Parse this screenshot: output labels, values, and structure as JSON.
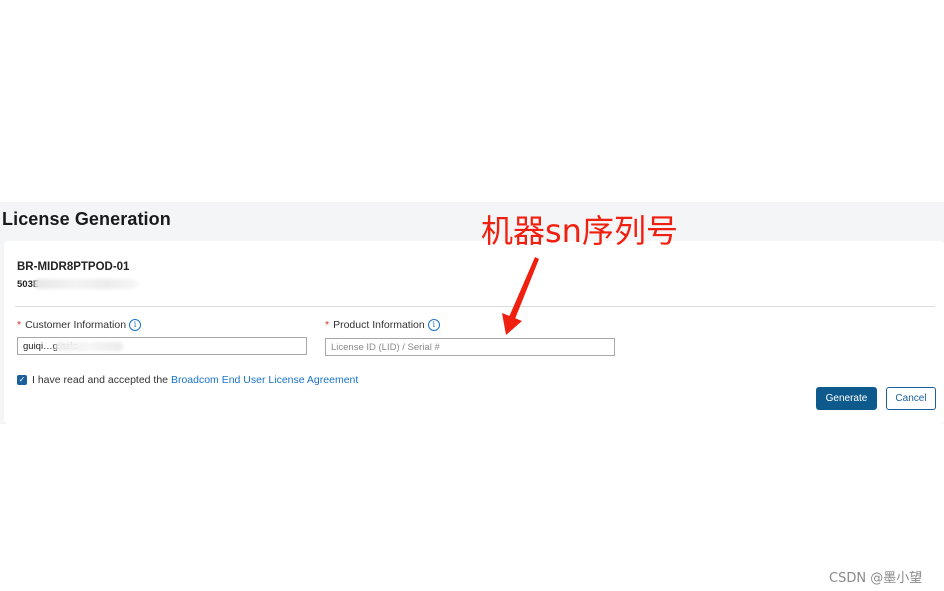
{
  "page": {
    "title": "License Generation"
  },
  "device": {
    "name": "BR-MIDR8PTPOD-01",
    "serial_visible": "503E"
  },
  "form": {
    "customer": {
      "label": "Customer Information",
      "value": "guiqi…g.asia",
      "required_mark": "*"
    },
    "product": {
      "label": "Product Information",
      "placeholder": "License ID (LID) / Serial #",
      "required_mark": "*"
    },
    "agreement": {
      "checked": true,
      "text": "I have read and accepted the ",
      "link": "Broadcom End User License Agreement"
    },
    "info_icon_glyph": "i"
  },
  "buttons": {
    "generate": "Generate",
    "cancel": "Cancel"
  },
  "annotation": {
    "text": "机器sn序列号",
    "color": "#f02010"
  },
  "watermark": "CSDN @墨小望",
  "colors": {
    "primary": "#0f5a8c",
    "link": "#1a73c9",
    "required": "#d93025"
  }
}
